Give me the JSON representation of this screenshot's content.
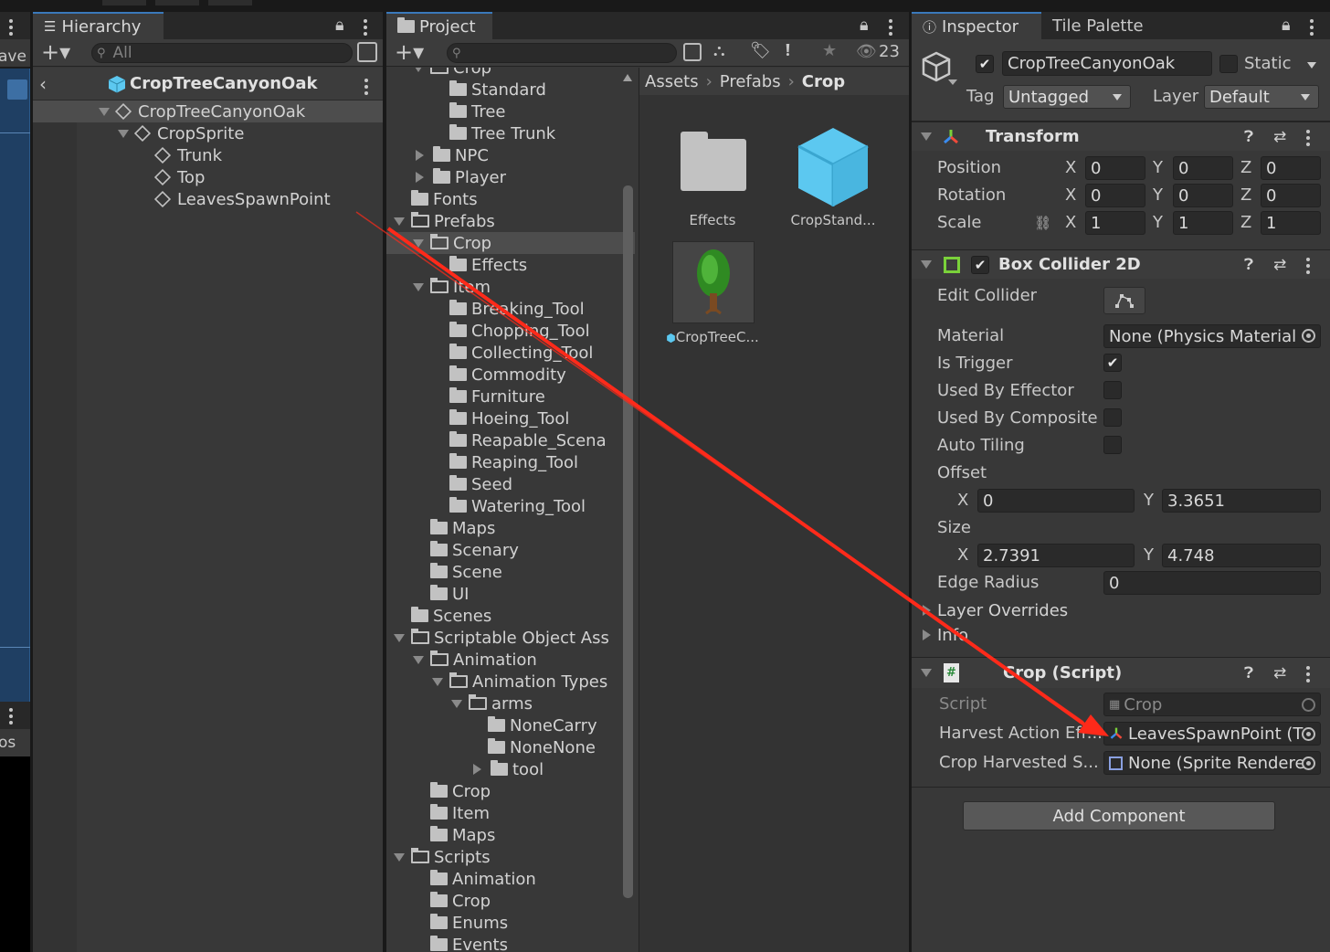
{
  "left_strip": {
    "text1": "ave",
    "text2": "os"
  },
  "hierarchy": {
    "tab": "Hierarchy",
    "search_placeholder": "All",
    "scene": "CropTreeCanyonOak",
    "items": [
      {
        "label": "CropTreeCanyonOak"
      },
      {
        "label": "CropSprite"
      },
      {
        "label": "Trunk"
      },
      {
        "label": "Top"
      },
      {
        "label": "LeavesSpawnPoint"
      }
    ]
  },
  "project": {
    "tab": "Project",
    "count": "23",
    "tree": [
      {
        "label": "Crop",
        "indent": 2,
        "fold": "open",
        "icon": "open"
      },
      {
        "label": "Standard",
        "indent": 3,
        "fold": "",
        "icon": "closed"
      },
      {
        "label": "Tree",
        "indent": 3,
        "fold": "",
        "icon": "closed"
      },
      {
        "label": "Tree Trunk",
        "indent": 3,
        "fold": "",
        "icon": "closed"
      },
      {
        "label": "NPC",
        "indent": 2,
        "fold": "closed",
        "icon": "closed"
      },
      {
        "label": "Player",
        "indent": 2,
        "fold": "closed",
        "icon": "closed"
      },
      {
        "label": "Fonts",
        "indent": 1,
        "fold": "",
        "icon": "closed"
      },
      {
        "label": "Prefabs",
        "indent": 1,
        "fold": "open",
        "icon": "open"
      },
      {
        "label": "Crop",
        "indent": 2,
        "fold": "open",
        "icon": "open",
        "selected": true
      },
      {
        "label": "Effects",
        "indent": 3,
        "fold": "",
        "icon": "closed"
      },
      {
        "label": "Item",
        "indent": 2,
        "fold": "open",
        "icon": "open"
      },
      {
        "label": "Breaking_Tool",
        "indent": 3,
        "fold": "",
        "icon": "closed"
      },
      {
        "label": "Chopping_Tool",
        "indent": 3,
        "fold": "",
        "icon": "closed"
      },
      {
        "label": "Collecting_Tool",
        "indent": 3,
        "fold": "",
        "icon": "closed"
      },
      {
        "label": "Commodity",
        "indent": 3,
        "fold": "",
        "icon": "closed"
      },
      {
        "label": "Furniture",
        "indent": 3,
        "fold": "",
        "icon": "closed"
      },
      {
        "label": "Hoeing_Tool",
        "indent": 3,
        "fold": "",
        "icon": "closed"
      },
      {
        "label": "Reapable_Scena",
        "indent": 3,
        "fold": "",
        "icon": "closed"
      },
      {
        "label": "Reaping_Tool",
        "indent": 3,
        "fold": "",
        "icon": "closed"
      },
      {
        "label": "Seed",
        "indent": 3,
        "fold": "",
        "icon": "closed"
      },
      {
        "label": "Watering_Tool",
        "indent": 3,
        "fold": "",
        "icon": "closed"
      },
      {
        "label": "Maps",
        "indent": 2,
        "fold": "",
        "icon": "closed"
      },
      {
        "label": "Scenary",
        "indent": 2,
        "fold": "",
        "icon": "closed"
      },
      {
        "label": "Scene",
        "indent": 2,
        "fold": "",
        "icon": "closed"
      },
      {
        "label": "UI",
        "indent": 2,
        "fold": "",
        "icon": "closed"
      },
      {
        "label": "Scenes",
        "indent": 1,
        "fold": "",
        "icon": "closed"
      },
      {
        "label": "Scriptable Object Ass",
        "indent": 1,
        "fold": "open",
        "icon": "open"
      },
      {
        "label": "Animation",
        "indent": 2,
        "fold": "open",
        "icon": "open"
      },
      {
        "label": "Animation Types",
        "indent": 3,
        "fold": "open",
        "icon": "open"
      },
      {
        "label": "arms",
        "indent": 4,
        "fold": "open",
        "icon": "open"
      },
      {
        "label": "NoneCarry",
        "indent": 5,
        "fold": "",
        "icon": "closed"
      },
      {
        "label": "NoneNone",
        "indent": 5,
        "fold": "",
        "icon": "closed"
      },
      {
        "label": "tool",
        "indent": 5,
        "fold": "closed",
        "icon": "closed"
      },
      {
        "label": "Crop",
        "indent": 2,
        "fold": "",
        "icon": "closed"
      },
      {
        "label": "Item",
        "indent": 2,
        "fold": "",
        "icon": "closed"
      },
      {
        "label": "Maps",
        "indent": 2,
        "fold": "",
        "icon": "closed"
      },
      {
        "label": "Scripts",
        "indent": 1,
        "fold": "open",
        "icon": "open"
      },
      {
        "label": "Animation",
        "indent": 2,
        "fold": "",
        "icon": "closed"
      },
      {
        "label": "Crop",
        "indent": 2,
        "fold": "",
        "icon": "closed"
      },
      {
        "label": "Enums",
        "indent": 2,
        "fold": "",
        "icon": "closed"
      },
      {
        "label": "Events",
        "indent": 2,
        "fold": "",
        "icon": "closed"
      }
    ],
    "breadcrumb": [
      "Assets",
      "Prefabs",
      "Crop"
    ],
    "assets": [
      {
        "label": "Effects"
      },
      {
        "label": "CropStand..."
      },
      {
        "label": "CropTreeC..."
      }
    ]
  },
  "inspector": {
    "tab": "Inspector",
    "tab2": "Tile Palette",
    "object_name": "CropTreeCanyonOak",
    "static": "Static",
    "tag_label": "Tag",
    "tag": "Untagged",
    "layer_label": "Layer",
    "layer": "Default",
    "transform": {
      "title": "Transform",
      "rows": [
        {
          "label": "Position",
          "x": "0",
          "y": "0",
          "z": "0"
        },
        {
          "label": "Rotation",
          "x": "0",
          "y": "0",
          "z": "0"
        },
        {
          "label": "Scale",
          "x": "1",
          "y": "1",
          "z": "1"
        }
      ]
    },
    "box_collider": {
      "title": "Box Collider 2D",
      "edit_collider": "Edit Collider",
      "material_label": "Material",
      "material": "None (Physics Material",
      "is_trigger": "Is Trigger",
      "used_by_effector": "Used By Effector",
      "used_by_composite": "Used By Composite",
      "auto_tiling": "Auto Tiling",
      "offset": "Offset",
      "offset_x": "0",
      "offset_y": "3.3651",
      "size": "Size",
      "size_x": "2.7391",
      "size_y": "4.748",
      "edge_radius_label": "Edge Radius",
      "edge_radius": "0",
      "layer_overrides": "Layer Overrides",
      "info": "Info"
    },
    "crop_script": {
      "title": "Crop (Script)",
      "script_label": "Script",
      "script": "Crop",
      "harvest_label": "Harvest Action Eff...",
      "harvest": "LeavesSpawnPoint (T",
      "harvested_label": "Crop Harvested S...",
      "harvested": "None (Sprite Rendere"
    },
    "add_component": "Add Component"
  },
  "colors": {
    "accent": "#3a79bb",
    "selection": "#4d4d4d",
    "annotation_arrow": "#ff2a1a",
    "cube": "#5cc8f0"
  }
}
